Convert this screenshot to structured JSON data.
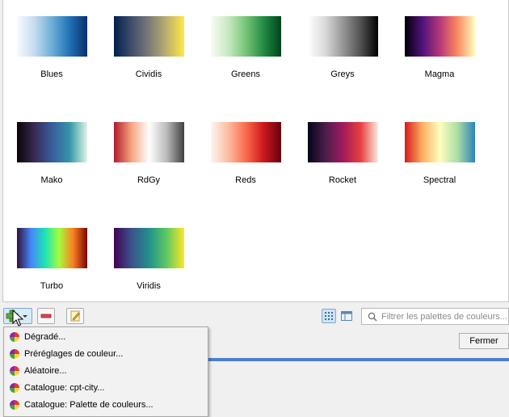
{
  "ramps": [
    {
      "name": "Blues",
      "colors": [
        "#f7fbff",
        "#c6dbef",
        "#6baed6",
        "#2171b5",
        "#08306b"
      ]
    },
    {
      "name": "Cividis",
      "colors": [
        "#00204d",
        "#414d6b",
        "#7c7b78",
        "#bcaf6f",
        "#ffe945"
      ]
    },
    {
      "name": "Greens",
      "colors": [
        "#f7fcf5",
        "#c7e9c0",
        "#74c476",
        "#238b45",
        "#00441b"
      ]
    },
    {
      "name": "Greys",
      "colors": [
        "#ffffff",
        "#d9d9d9",
        "#969696",
        "#525252",
        "#000000"
      ]
    },
    {
      "name": "Magma",
      "colors": [
        "#000004",
        "#51127c",
        "#b73779",
        "#fc8961",
        "#fcfdbf"
      ]
    },
    {
      "name": "Mako",
      "colors": [
        "#0b0405",
        "#382a54",
        "#395d9c",
        "#3496a9",
        "#deF5e5"
      ]
    },
    {
      "name": "RdGy",
      "colors": [
        "#b2182b",
        "#f4a582",
        "#ffffff",
        "#bababa",
        "#404040"
      ]
    },
    {
      "name": "Reds",
      "colors": [
        "#fff5f0",
        "#fcbba1",
        "#fb6a4a",
        "#cb181d",
        "#67000d"
      ]
    },
    {
      "name": "Rocket",
      "colors": [
        "#03051a",
        "#4c1d4b",
        "#a11a5b",
        "#e83f3f",
        "#faebdd"
      ]
    },
    {
      "name": "Spectral",
      "colors": [
        "#d7191c",
        "#fdae61",
        "#ffffbf",
        "#abdda4",
        "#2b83ba"
      ]
    },
    {
      "name": "Turbo",
      "colors": [
        "#30123b",
        "#4686fb",
        "#1be5b5",
        "#a4fc3c",
        "#fb7e21",
        "#7a0403"
      ]
    },
    {
      "name": "Viridis",
      "colors": [
        "#440154",
        "#3b528b",
        "#21918c",
        "#5ec962",
        "#fde725"
      ]
    }
  ],
  "toolbar": {
    "add_icon": "plus-icon",
    "remove_icon": "minus-icon",
    "edit_icon": "pencil-icon",
    "view_icons_icon": "icon-grid-icon",
    "view_list_icon": "list-view-icon"
  },
  "filter": {
    "placeholder": "Filtrer les palettes de couleurs..."
  },
  "close_label": "Fermer",
  "add_menu": {
    "items": [
      {
        "label": "Dégradé..."
      },
      {
        "label": "Préréglages de couleur..."
      },
      {
        "label": "Aléatoire..."
      },
      {
        "label": "Catalogue: cpt-city..."
      },
      {
        "label": "Catalogue: Palette de couleurs..."
      }
    ]
  },
  "colors": {
    "accent": "#4a7fd0",
    "selected_button": "#d8e9f7"
  }
}
